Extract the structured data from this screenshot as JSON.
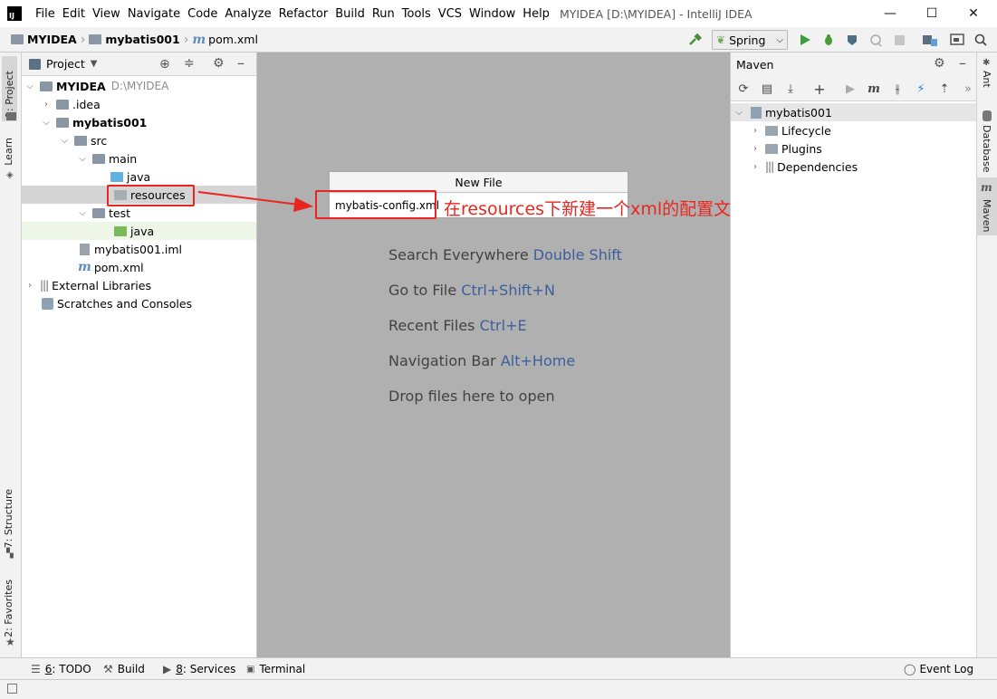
{
  "window": {
    "title": "MYIDEA [D:\\MYIDEA] - IntelliJ IDEA",
    "app_icon_text": "IJ",
    "controls": [
      "—",
      "☐",
      "✕"
    ]
  },
  "menu": [
    {
      "label": "File"
    },
    {
      "label": "Edit"
    },
    {
      "label": "View"
    },
    {
      "label": "Navigate"
    },
    {
      "label": "Code"
    },
    {
      "label": "Analyze"
    },
    {
      "label": "Refactor"
    },
    {
      "label": "Build"
    },
    {
      "label": "Run"
    },
    {
      "label": "Tools"
    },
    {
      "label": "VCS"
    },
    {
      "label": "Window"
    },
    {
      "label": "Help"
    }
  ],
  "breadcrumb": {
    "project": "MYIDEA",
    "module": "mybatis001",
    "file": "pom.xml"
  },
  "toolbar": {
    "run_config": "Spring"
  },
  "left_strip": {
    "project_tab": "1: Project",
    "learn_tab": "Learn",
    "structure_tab": "7: Structure",
    "favorites_tab": "2: Favorites"
  },
  "project_panel": {
    "title": "Project",
    "tree": {
      "root": {
        "label": "MYIDEA",
        "path": "D:\\MYIDEA"
      },
      "idea": ".idea",
      "module": "mybatis001",
      "src": "src",
      "main": "main",
      "main_java": "java",
      "resources": "resources",
      "test": "test",
      "test_java": "java",
      "iml": "mybatis001.iml",
      "pom": "pom.xml",
      "external_libraries": "External Libraries",
      "scratches": "Scratches and Consoles"
    }
  },
  "editor": {
    "hints": [
      {
        "text": "Search Everywhere",
        "key": "Double Shift"
      },
      {
        "text": "Go to File",
        "key": "Ctrl+Shift+N"
      },
      {
        "text": "Recent Files",
        "key": "Ctrl+E"
      },
      {
        "text": "Navigation Bar",
        "key": "Alt+Home"
      },
      {
        "text": "Drop files here to open",
        "key": ""
      }
    ]
  },
  "new_file_dialog": {
    "title": "New File",
    "value": "mybatis-config.xml"
  },
  "annotation": {
    "text": "在resources下新建一个xml的配置文件",
    "color": "#e8261f"
  },
  "maven_panel": {
    "title": "Maven",
    "tree": {
      "project": "mybatis001",
      "lifecycle": "Lifecycle",
      "plugins": "Plugins",
      "dependencies": "Dependencies"
    }
  },
  "right_strip": {
    "ant_tab": "Ant",
    "database_tab": "Database",
    "maven_tab": "Maven"
  },
  "bottom_tools": {
    "todo": {
      "num": "6",
      "label": ": TODO"
    },
    "build": "Build",
    "services": {
      "num": "8",
      "label": ": Services"
    },
    "terminal": "Terminal",
    "event_log": "Event Log"
  }
}
